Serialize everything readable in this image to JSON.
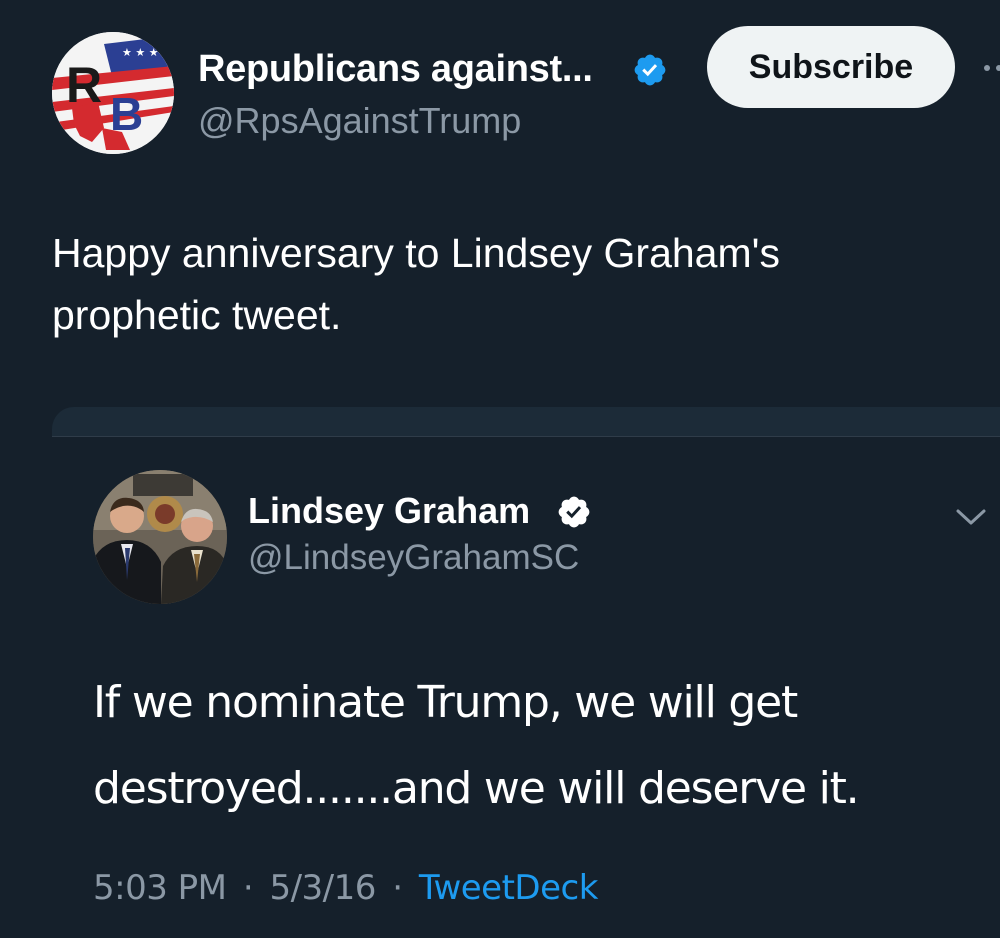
{
  "author": {
    "name": "Republicans against...",
    "handle": "@RpsAgainstTrump",
    "avatar_icon": "rb-logo-icon",
    "logo_text": "RB",
    "verified_icon": "verified-badge-icon"
  },
  "actions": {
    "subscribe_label": "Subscribe",
    "more_icon": "more-icon"
  },
  "tweet": {
    "line1": "Happy anniversary to Lindsey Graham's",
    "line2": "prophetic tweet."
  },
  "quoted": {
    "name": "Lindsey Graham",
    "handle": "@LindseyGrahamSC",
    "verified_icon": "verified-badge-icon",
    "menu_icon": "chevron-down-icon",
    "line1": "If we nominate Trump, we will get",
    "line2": "destroyed.......and we will deserve it.",
    "time": "5:03 PM",
    "date": "5/3/16",
    "separator": "·",
    "source": "TweetDeck"
  },
  "colors": {
    "background": "#15202b",
    "text": "#ffffff",
    "muted": "#8b98a5",
    "link": "#1d9bf0",
    "verified": "#1d9bf0"
  }
}
